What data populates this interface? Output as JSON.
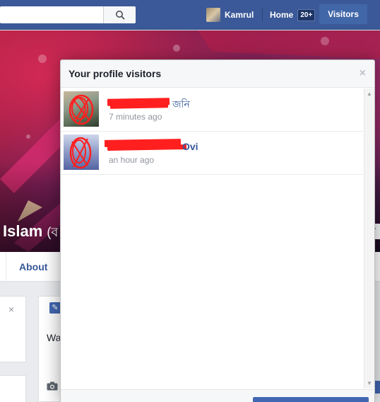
{
  "topbar": {
    "search": {
      "placeholder": ""
    },
    "user_name": "Kamrul",
    "home_label": "Home",
    "home_badge": "20+",
    "visitors_label": "Visitors"
  },
  "profile": {
    "name": "Islam",
    "name_suffix": "(ব",
    "tab_about": "About",
    "left_card_close": "×",
    "mid_card_text": "Wa"
  },
  "dialog": {
    "title": "Your profile visitors",
    "close": "×",
    "visitors": [
      {
        "name_visible": "জনি",
        "time": "7 minutes ago"
      },
      {
        "name_visible": "Ovi",
        "time": "an hour ago"
      }
    ]
  },
  "icons": {
    "search": "search-icon",
    "close": "close-icon",
    "pencil": "pencil-icon",
    "camera": "camera-icon"
  },
  "colors": {
    "brand": "#3b5998",
    "link": "#365899",
    "redaction": "#ff1f1f"
  }
}
